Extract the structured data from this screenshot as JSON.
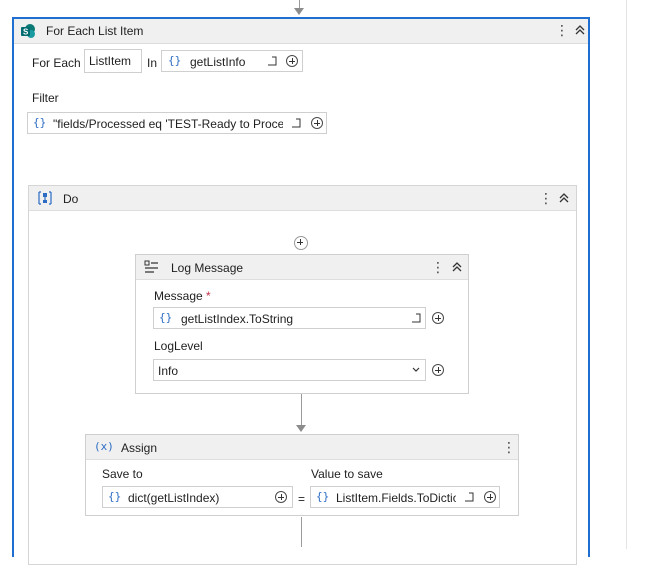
{
  "foreach": {
    "title": "For Each List Item",
    "for_each_label": "For Each",
    "item_name": "ListItem",
    "in_label": "In",
    "collection_value": "getListInfo",
    "filter_label": "Filter",
    "filter_value": "\"fields/Processed eq 'TEST-Ready to Proces"
  },
  "do": {
    "title": "Do"
  },
  "log_message": {
    "title": "Log Message",
    "message_label": "Message",
    "required_mark": "*",
    "message_value": "getListIndex.ToString",
    "loglevel_label": "LogLevel",
    "loglevel_value": "Info"
  },
  "assign": {
    "title": "Assign",
    "icon_text": "(x)",
    "save_to_label": "Save to",
    "save_to_value": "dict(getListIndex)",
    "equals": "=",
    "value_label": "Value to save",
    "value_value": "ListItem.Fields.ToDictio"
  },
  "icons": {
    "expression_icon": "{}",
    "menu_icon": "⋮"
  },
  "colors": {
    "accent": "#1f6fd1",
    "expression": "#2b6cc4"
  }
}
